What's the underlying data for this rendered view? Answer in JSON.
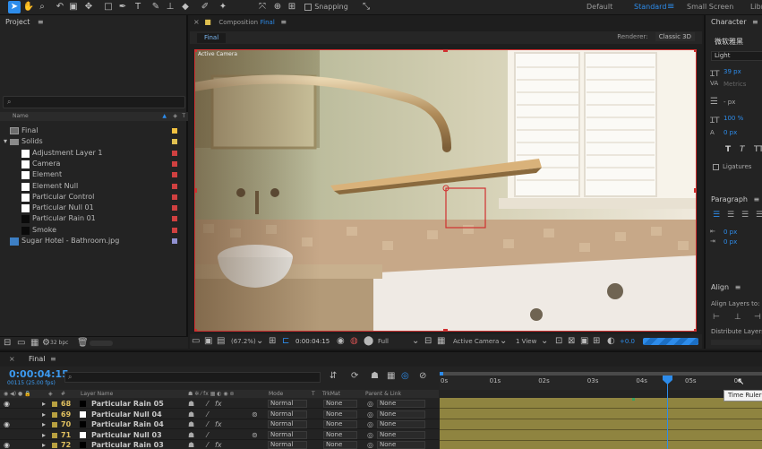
{
  "workspaces": [
    "Default",
    "Standard",
    "Small Screen",
    "Libr"
  ],
  "toolbar": {
    "snapping_label": "Snapping"
  },
  "project": {
    "title": "Project",
    "search_placeholder": "⌕",
    "col_name": "Name",
    "items": [
      {
        "name": "Final",
        "type": "comp",
        "color": "#f0c040",
        "indent": 0
      },
      {
        "name": "Solids",
        "type": "folder",
        "color": "#e0c050",
        "indent": 0
      },
      {
        "name": "Adjustment Layer 1",
        "type": "solid",
        "color": "#d04040",
        "indent": 1
      },
      {
        "name": "Camera",
        "type": "solid",
        "color": "#d04040",
        "indent": 1
      },
      {
        "name": "Element",
        "type": "solid",
        "color": "#d04040",
        "indent": 1
      },
      {
        "name": "Element Null",
        "type": "solid",
        "color": "#d04040",
        "indent": 1
      },
      {
        "name": "Particular Control",
        "type": "solid",
        "color": "#d04040",
        "indent": 1
      },
      {
        "name": "Particular Null 01",
        "type": "solid",
        "color": "#d04040",
        "indent": 1
      },
      {
        "name": "Particular Rain 01",
        "type": "solid-dark",
        "color": "#d04040",
        "indent": 1
      },
      {
        "name": "Smoke",
        "type": "solid-dark",
        "color": "#d04040",
        "indent": 1
      },
      {
        "name": "Sugar Hotel - Bathroom.jpg",
        "type": "image",
        "color": "#9090d0",
        "indent": 0
      }
    ],
    "bpc": "32 bpc"
  },
  "composition": {
    "title_prefix": "Composition",
    "title_name": "Final",
    "tab": "Final",
    "renderer_label": "Renderer:",
    "renderer_value": "Classic 3D",
    "camera_label": "Active Camera",
    "zoom": "(67.2%)",
    "timecode": "0:00:04:15",
    "resolution": "Full",
    "view_camera": "Active Camera",
    "views": "1 View",
    "exposure": "+0.0"
  },
  "character": {
    "title": "Character",
    "font": "微软雅黑",
    "style": "Light",
    "size": "39 px",
    "tracking": "Metrics",
    "stroke": "- px",
    "vscale": "100 %",
    "baseline": "0 px",
    "ligatures": "Ligatures"
  },
  "paragraph": {
    "title": "Paragraph",
    "indent1": "0 px",
    "indent2": "0 px"
  },
  "align": {
    "title": "Align",
    "align_to": "Align Layers to:",
    "distribute": "Distribute Layers:"
  },
  "timeline": {
    "tab": "Final",
    "timecode": "0:00:04:15",
    "frames": "00115 (25.00 fps)",
    "col_layer_name": "Layer Name",
    "col_mode": "Mode",
    "col_t": "T",
    "col_trkmat": "TrkMat",
    "col_parent": "Parent & Link",
    "ruler": [
      "0s",
      "01s",
      "02s",
      "03s",
      "04s",
      "05s",
      "06"
    ],
    "tooltip": "Time Ruler",
    "layers": [
      {
        "num": "68",
        "name": "Particular Rain 05",
        "mode": "Normal",
        "trkmat": "None",
        "parent": "None",
        "fx": true
      },
      {
        "num": "69",
        "name": "Particular Null 04",
        "mode": "Normal",
        "trkmat": "None",
        "parent": "None",
        "fx": false
      },
      {
        "num": "70",
        "name": "Particular Rain 04",
        "mode": "Normal",
        "trkmat": "None",
        "parent": "None",
        "fx": true
      },
      {
        "num": "71",
        "name": "Particular Null 03",
        "mode": "Normal",
        "trkmat": "None",
        "parent": "None",
        "fx": false
      },
      {
        "num": "72",
        "name": "Particular Rain 03",
        "mode": "Normal",
        "trkmat": "None",
        "parent": "None",
        "fx": true
      }
    ]
  }
}
